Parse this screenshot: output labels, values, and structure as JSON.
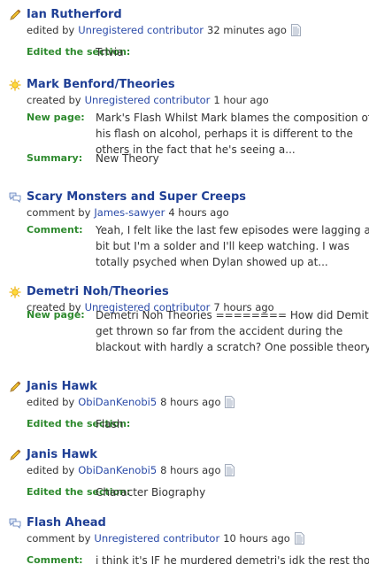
{
  "feed": {
    "entries": [
      {
        "type": "edit",
        "icon": "pencil-icon",
        "title": "Ian Rutherford",
        "action": "edited by",
        "user": "Unregistered contributor",
        "time": "32 minutes ago",
        "has_diff": true,
        "details": [
          {
            "label": "Edited the section:",
            "lines": [
              "Trivia"
            ]
          }
        ]
      },
      {
        "type": "new-page",
        "icon": "sun-icon",
        "title": "Mark Benford/Theories",
        "action": "created by",
        "user": "Unregistered contributor",
        "time": "1 hour ago",
        "has_diff": false,
        "details": [
          {
            "label": "New page:",
            "lines": [
              "Mark's Flash Whilst Mark blames the composition of",
              "his flash on alcohol, perhaps it is different to the",
              "others in the fact that he's seeing a..."
            ]
          },
          {
            "label": "Summary:",
            "lines": [
              "New Theory"
            ]
          }
        ]
      },
      {
        "type": "comment",
        "icon": "speech-bubbles-icon",
        "title": "Scary Monsters and Super Creeps",
        "action": "comment by",
        "user": "James-sawyer",
        "time": "4 hours ago",
        "has_diff": false,
        "details": [
          {
            "label": "Comment:",
            "lines": [
              "Yeah, I felt like the last few episodes were lagging ab",
              "bit but I'm a solder and I'll keep watching. I was",
              "totally psyched when Dylan showed up at..."
            ]
          }
        ]
      },
      {
        "type": "new-page",
        "icon": "sun-icon",
        "title": "Demetri Noh/Theories",
        "action": "created by",
        "user": "Unregistered contributor",
        "time": "7 hours ago",
        "has_diff": false,
        "details": [
          {
            "label": "New page:",
            "lines": [
              "Demetri Noh Theories ======== How did Demitri",
              "get thrown so far from the accident during the",
              "blackout with hardly a scratch? One possible theory..."
            ]
          }
        ]
      },
      {
        "type": "edit",
        "icon": "pencil-icon",
        "title": "Janis Hawk",
        "action": "edited by",
        "user": "ObiDanKenobi5",
        "time": "8 hours ago",
        "has_diff": true,
        "details": [
          {
            "label": "Edited the section:",
            "lines": [
              "Flash"
            ]
          }
        ]
      },
      {
        "type": "edit",
        "icon": "pencil-icon",
        "title": "Janis Hawk",
        "action": "edited by",
        "user": "ObiDanKenobi5",
        "time": "8 hours ago",
        "has_diff": true,
        "details": [
          {
            "label": "Edited the section:",
            "lines": [
              "Character Biography"
            ]
          }
        ]
      },
      {
        "type": "comment",
        "icon": "speech-bubbles-icon",
        "title": "Flash Ahead",
        "action": "comment by",
        "user": "Unregistered contributor",
        "time": "10 hours ago",
        "has_diff": true,
        "details": [
          {
            "label": "Comment:",
            "lines": [
              "i think it's IF he murdered demetri's idk the rest thou"
            ]
          }
        ]
      }
    ]
  },
  "colors": {
    "title_link": "#1f3f95",
    "user_link": "#2a4aa8",
    "label_green": "#2e8a2e",
    "text": "#333333"
  }
}
